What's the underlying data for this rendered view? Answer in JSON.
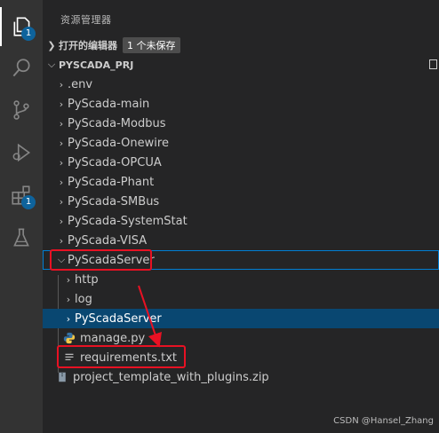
{
  "activity_bar": {
    "explorer_badge": "1",
    "extensions_badge": "1"
  },
  "sidebar": {
    "title": "资源管理器",
    "open_editors": {
      "label": "打开的编辑器",
      "unsaved": "1 个未保存"
    },
    "workspace": {
      "label": "PYSCADA_PRJ"
    },
    "items": [
      {
        "label": ".env",
        "kind": "folder",
        "expanded": false
      },
      {
        "label": "PyScada-main",
        "kind": "folder",
        "expanded": false
      },
      {
        "label": "PyScada-Modbus",
        "kind": "folder",
        "expanded": false
      },
      {
        "label": "PyScada-Onewire",
        "kind": "folder",
        "expanded": false
      },
      {
        "label": "PyScada-OPCUA",
        "kind": "folder",
        "expanded": false
      },
      {
        "label": "PyScada-Phant",
        "kind": "folder",
        "expanded": false
      },
      {
        "label": "PyScada-SMBus",
        "kind": "folder",
        "expanded": false
      },
      {
        "label": "PyScada-SystemStat",
        "kind": "folder",
        "expanded": false
      },
      {
        "label": "PyScada-VISA",
        "kind": "folder",
        "expanded": false
      },
      {
        "label": "PyScadaServer",
        "kind": "folder",
        "expanded": true
      },
      {
        "label": "http",
        "kind": "folder",
        "expanded": false
      },
      {
        "label": "log",
        "kind": "folder",
        "expanded": false
      },
      {
        "label": "PyScadaServer",
        "kind": "folder",
        "expanded": false
      },
      {
        "label": "manage.py",
        "kind": "python"
      },
      {
        "label": "requirements.txt",
        "kind": "text"
      },
      {
        "label": "project_template_with_plugins.zip",
        "kind": "zip"
      }
    ]
  },
  "watermark": "CSDN @Hansel_Zhang",
  "colors": {
    "annotation": "#e81123",
    "selection": "#094771",
    "badge": "#0e639c"
  }
}
